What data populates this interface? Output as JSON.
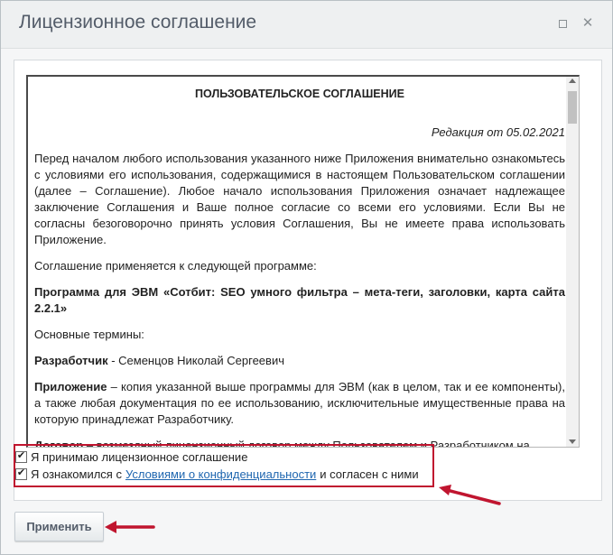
{
  "dialog": {
    "title": "Лицензионное соглашение",
    "maximize_icon": "maximize-icon",
    "close_icon": "close-icon"
  },
  "agreement": {
    "heading": "ПОЛЬЗОВАТЕЛЬСКОЕ СОГЛАШЕНИЕ",
    "revision": "Редакция от 05.02.2021",
    "intro": "Перед началом любого использования указанного ниже Приложения внимательно ознакомьтесь с условиями его использования, содержащимися в настоящем Пользовательском соглашении (далее – Соглашение). Любое начало использования Приложения означает надлежащее заключение Соглашения и Ваше полное согласие со всеми его условиями. Если Вы не согласны безоговорочно принять условия Соглашения, Вы не имеете права использовать Приложение.",
    "applies_to": "Соглашение применяется к следующей программе:",
    "program": "Программа для ЭВМ «Сотбит: SEO умного фильтра – мета-теги, заголовки, карта сайта 2.2.1»",
    "terms_heading": "Основные термины:",
    "developer_term": "Разработчик",
    "developer_def": " - Семенцов Николай Сергеевич",
    "app_term": "Приложение",
    "app_def": " – копия указанной выше программы для ЭВМ (как в целом, так и ее компоненты), а также любая документация по ее использованию, исключительные имущественные права на которую принадлежат Разработчику.",
    "contract_term": "Договор",
    "contract_def": " – возмездный лицензионный договор между Пользователем и Разработчиком на"
  },
  "checkboxes": {
    "accept_label": "Я принимаю лицензионное соглашение",
    "privacy_prefix": "Я ознакомился с",
    "privacy_link": "Условиями о конфиденциальности",
    "privacy_suffix": "и согласен с ними"
  },
  "footer": {
    "apply_label": "Применить"
  },
  "colors": {
    "highlight": "#c0152f",
    "link": "#2067b0"
  }
}
